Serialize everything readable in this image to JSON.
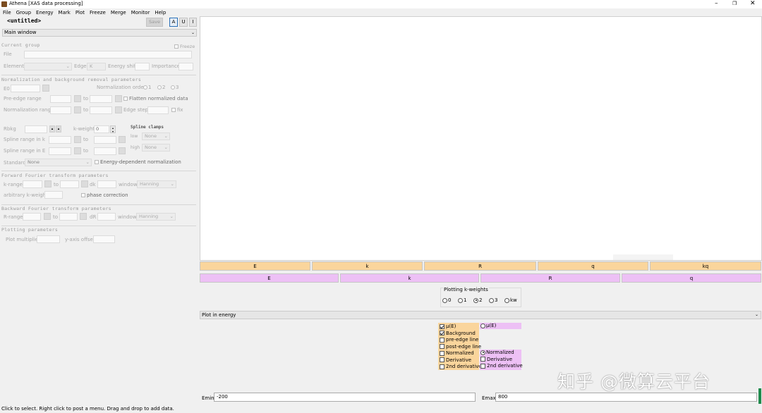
{
  "window": {
    "title": "Athena [XAS data processing]"
  },
  "menubar": [
    "File",
    "Group",
    "Energy",
    "Mark",
    "Plot",
    "Freeze",
    "Merge",
    "Monitor",
    "Help"
  ],
  "toolbar": {
    "group_name": "<untitled>",
    "save": "Save",
    "a": "A",
    "u": "U",
    "i": "I"
  },
  "view_select": "Main window",
  "current_group": {
    "header": "Current group",
    "freeze": "Freeze",
    "file": "File",
    "element": "Element",
    "edge": "Edge",
    "edge_value": "K",
    "energy_shift": "Energy shift",
    "importance": "Importance"
  },
  "normalization": {
    "header": "Normalization and background removal parameters",
    "e0": "E0",
    "norm_order": "Normalization order",
    "orders": [
      "1",
      "2",
      "3"
    ],
    "pre_edge": "Pre-edge range",
    "to1": "to",
    "flatten": "Flatten normalized data",
    "norm_range": "Normalization range",
    "to2": "to",
    "edge_step": "Edge step",
    "fix": "fix",
    "rbkg": "Rbkg",
    "kweight": "k-weight",
    "kweight_value": "0",
    "spline_clamps": "Spline clamps",
    "low": "low",
    "high": "high",
    "clamp_low": "None",
    "clamp_high": "None",
    "spline_k": "Spline range in k",
    "to3": "to",
    "spline_e": "Spline range in E",
    "to4": "to",
    "standard": "Standard",
    "standard_value": "None",
    "energy_dep": "Energy-dependent normalization"
  },
  "fft": {
    "header": "Forward Fourier transform parameters",
    "krange": "k-range",
    "to": "to",
    "dk": "dk",
    "window": "window",
    "window_value": "Hanning",
    "arb_kweight": "arbitrary k-weight",
    "phase_corr": "phase correction"
  },
  "bft": {
    "header": "Backward Fourier transform parameters",
    "rrange": "R-range",
    "to": "to",
    "dr": "dR",
    "window": "window",
    "window_value": "Hanning"
  },
  "plotting": {
    "header": "Plotting parameters",
    "multiplier": "Plot multiplier",
    "yoffset": "y-axis offset"
  },
  "plot_buttons_orange": [
    "E",
    "k",
    "R",
    "q",
    "kq"
  ],
  "plot_buttons_pink": [
    "E",
    "k",
    "R",
    "q"
  ],
  "kweights": {
    "title": "Plotting k-weights",
    "options": [
      "0",
      "1",
      "2",
      "3",
      "kw"
    ],
    "selected": "2"
  },
  "plot_in": "Plot in energy",
  "energy_options": {
    "left": [
      "μ(E)",
      "Background",
      "pre-edge line",
      "post-edge line",
      "Normalized",
      "Derivative",
      "2nd derivative"
    ],
    "left_checked": [
      true,
      true,
      false,
      false,
      false,
      false,
      false
    ],
    "right_top": "μ(E)",
    "right": [
      "Normalized",
      "Derivative",
      "2nd derivative"
    ],
    "right_selected": "Normalized"
  },
  "emin": {
    "label": "Emin",
    "value": "-200"
  },
  "emax": {
    "label": "Emax",
    "value": "800"
  },
  "watermark": "知乎 @微算云平台",
  "status": "Click to select. Right click to post a menu. Drag and drop to add data."
}
